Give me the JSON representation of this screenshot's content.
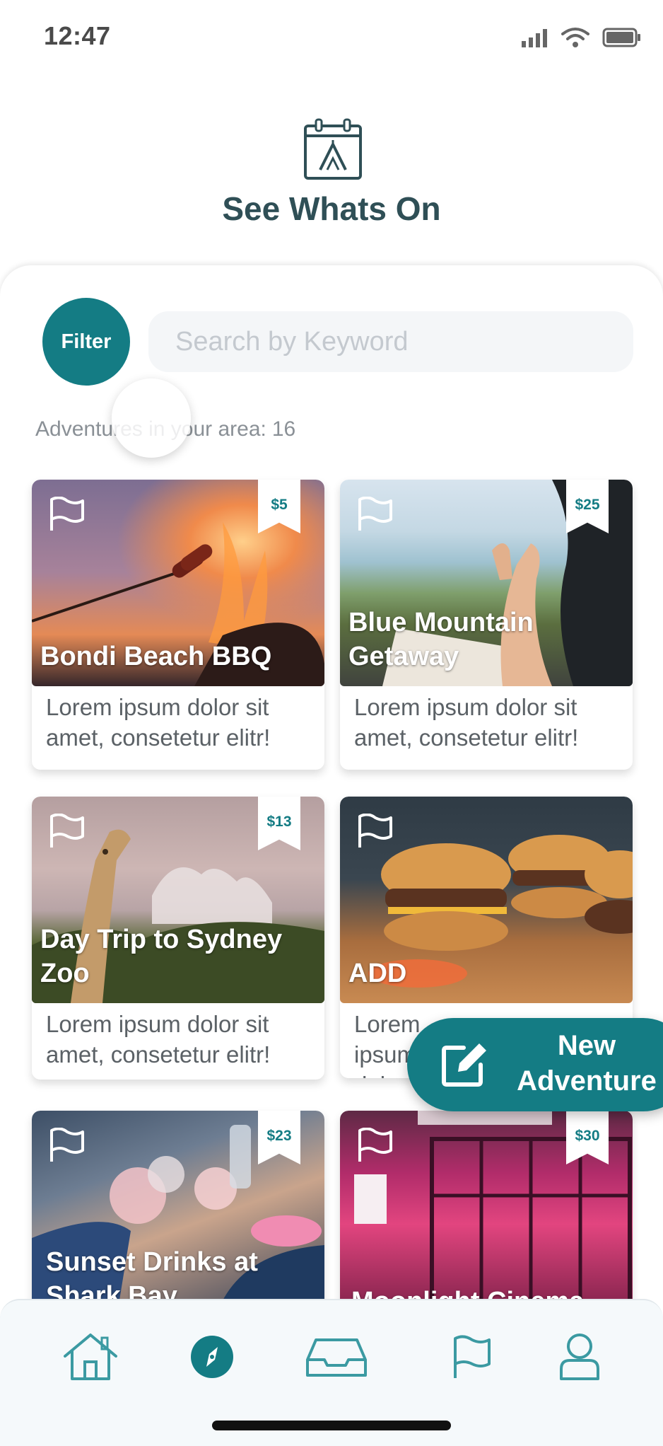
{
  "status_bar": {
    "time": "12:47",
    "signal_icon": "signal-bars-icon",
    "wifi_icon": "wifi-icon",
    "battery_icon": "battery-icon"
  },
  "header": {
    "icon": "calendar-tent-icon",
    "title": "See Whats On"
  },
  "filter": {
    "label": "Filter"
  },
  "search": {
    "placeholder": "Search by Keyword"
  },
  "adventures": {
    "count_label": "Adventures in your area:",
    "count": "16"
  },
  "cards": [
    {
      "title": "Bondi Beach BBQ",
      "price": "$5",
      "description": "Lorem ipsum dolor sit amet, consetetur elitr!"
    },
    {
      "title": "Blue Mountain Getaway",
      "price": "$25",
      "description": "Lorem ipsum dolor sit amet, consetetur elitr!"
    },
    {
      "title": "Day Trip to Sydney Zoo",
      "price": "$13",
      "description": "Lorem ipsum dolor sit amet, consetetur elitr!"
    },
    {
      "title": "ADD",
      "price": "",
      "description": "Lorem ipsum dolor sit amet,"
    },
    {
      "title": "Sunset Drinks at Shark Bay",
      "price": "$23",
      "description": ""
    },
    {
      "title": "Moonlight Cinema",
      "price": "$30",
      "description": ""
    }
  ],
  "fab": {
    "label": "New Adventure",
    "icon": "edit-icon"
  },
  "bottom_nav": {
    "items": [
      {
        "name": "home",
        "icon": "home-icon"
      },
      {
        "name": "explore",
        "icon": "compass-icon",
        "active": true
      },
      {
        "name": "inbox",
        "icon": "inbox-icon"
      },
      {
        "name": "flags",
        "icon": "flag-icon"
      },
      {
        "name": "profile",
        "icon": "user-icon"
      }
    ]
  },
  "colors": {
    "primary": "#147c84",
    "heading": "#2f4f56",
    "muted_text": "#8a9096",
    "body_text": "#5b6166",
    "input_bg": "#f4f6f8",
    "nav_bg": "#f5f9fb",
    "nav_icon": "#3b9aa2"
  }
}
